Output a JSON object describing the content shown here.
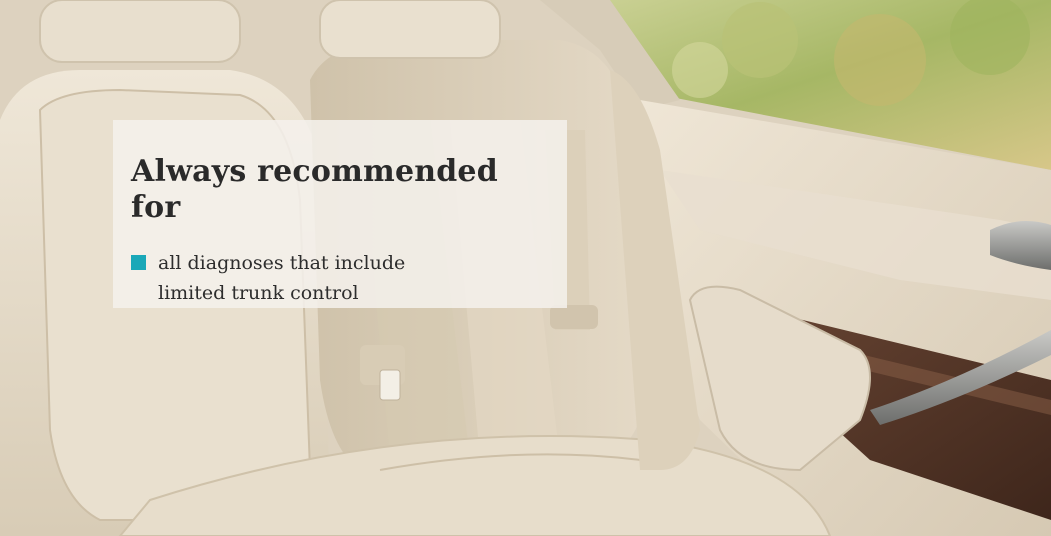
{
  "card": {
    "title": "Always recommended for",
    "bullets": [
      {
        "lines": [
          "all diagnoses that include",
          "limited trunk control"
        ]
      }
    ]
  },
  "colors": {
    "accent": "#1aa8b8",
    "upholstery": "#e6dccb",
    "wood_trim": "#5a3a2a",
    "foliage": "#a9b86a"
  },
  "scene": {
    "subject": "car-rear-seat-photo"
  }
}
